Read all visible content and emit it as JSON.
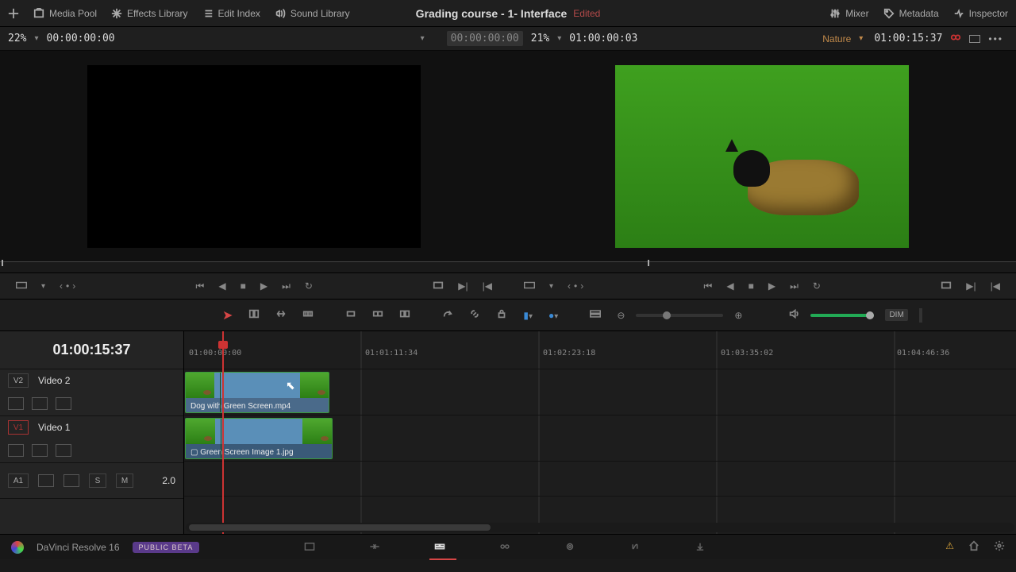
{
  "topbar": {
    "mediaPool": "Media Pool",
    "effects": "Effects Library",
    "editIndex": "Edit Index",
    "sound": "Sound Library",
    "title": "Grading course - 1- Interface",
    "edited": "Edited",
    "mixer": "Mixer",
    "metadata": "Metadata",
    "inspector": "Inspector"
  },
  "tcbar": {
    "leftZoom": "22%",
    "leftTC": "00:00:00:00",
    "midTC1": "00:00:00:00",
    "midZoom": "21%",
    "midTC2": "01:00:00:03",
    "clipName": "Nature",
    "rightTC": "01:00:15:37"
  },
  "transport": {
    "loop": "⟳"
  },
  "tools": {
    "dimLabel": "DIM"
  },
  "timeline": {
    "masterTC": "01:00:15:37",
    "ruler": [
      "01:00:00:00",
      "01:01:11:34",
      "01:02:23:18",
      "01:03:35:02",
      "01:04:46:36"
    ],
    "tracks": {
      "v2": {
        "tag": "V2",
        "name": "Video 2"
      },
      "v1": {
        "tag": "V1",
        "name": "Video 1"
      },
      "a1": {
        "tag": "A1",
        "ch": "2.0"
      }
    },
    "clips": {
      "v2": {
        "label1": "Dog with",
        "label2": "Green Screen.mp4"
      },
      "v1": {
        "label": "Green Screen Image 1.jpg"
      }
    }
  },
  "bottom": {
    "app": "DaVinci Resolve 16",
    "beta": "PUBLIC BETA"
  }
}
